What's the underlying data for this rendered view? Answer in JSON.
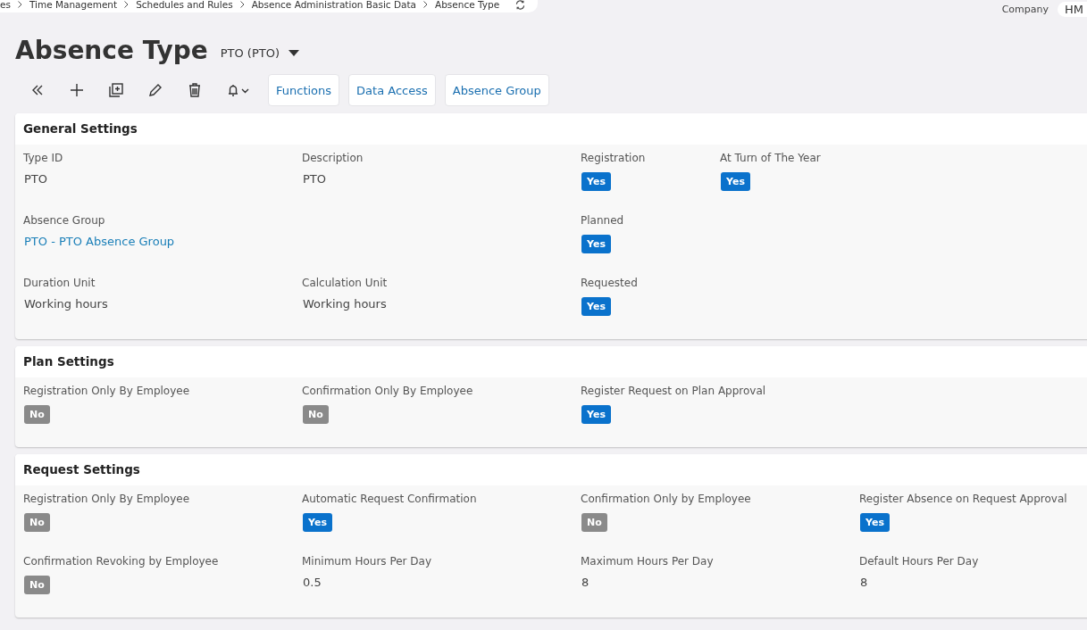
{
  "breadcrumbs": [
    "es",
    "Time Management",
    "Schedules and Rules",
    "Absence Administration Basic Data",
    "Absence Type"
  ],
  "company": {
    "label": "Company",
    "value": "HM"
  },
  "title": "Absence Type",
  "record": "PTO (PTO)",
  "toolbar_buttons": [
    "Functions",
    "Data Access",
    "Absence Group"
  ],
  "sections": [
    {
      "title": "General Settings",
      "rows": [
        [
          {
            "label": "Type ID",
            "kind": "text",
            "value": "PTO"
          },
          "",
          {
            "label": "Description",
            "kind": "text",
            "value": "PTO"
          },
          "",
          {
            "label": "Registration",
            "kind": "toggle",
            "on": true,
            "value": "Yes"
          },
          {
            "label": "At Turn of The Year",
            "kind": "toggle",
            "on": true,
            "value": "Yes"
          }
        ],
        [
          {
            "label": "Absence Group",
            "kind": "link",
            "value": "PTO - PTO Absence Group"
          },
          "",
          "",
          "",
          {
            "label": "Planned",
            "kind": "toggle",
            "on": true,
            "value": "Yes"
          }
        ],
        [
          {
            "label": "Duration Unit",
            "kind": "text",
            "value": "Working hours"
          },
          "",
          {
            "label": "Calculation Unit",
            "kind": "text",
            "value": "Working hours"
          },
          "",
          {
            "label": "Requested",
            "kind": "toggle",
            "on": true,
            "value": "Yes"
          }
        ]
      ]
    },
    {
      "title": "Plan Settings",
      "rows": [
        [
          {
            "label": "Registration Only By Employee",
            "kind": "toggle",
            "on": false,
            "value": "No"
          },
          "",
          {
            "label": "Confirmation Only By Employee",
            "kind": "toggle",
            "on": false,
            "value": "No"
          },
          "",
          {
            "label": "Register Request on Plan Approval",
            "kind": "toggle",
            "on": true,
            "value": "Yes"
          }
        ]
      ]
    },
    {
      "title": "Request Settings",
      "rows": [
        [
          {
            "label": "Registration Only By Employee",
            "kind": "toggle",
            "on": false,
            "value": "No"
          },
          "",
          {
            "label": "Automatic Request Confirmation",
            "kind": "toggle",
            "on": true,
            "value": "Yes"
          },
          "",
          {
            "label": "Confirmation Only by Employee",
            "kind": "toggle",
            "on": false,
            "value": "No"
          },
          "",
          {
            "label": "Register Absence on Request Approval",
            "kind": "toggle",
            "on": true,
            "value": "Yes"
          }
        ],
        [
          {
            "label": "Confirmation Revoking by Employee",
            "kind": "toggle",
            "on": false,
            "value": "No"
          },
          "",
          {
            "label": "Minimum Hours Per Day",
            "kind": "text",
            "value": "0.5"
          },
          "",
          {
            "label": "Maximum Hours Per Day",
            "kind": "text",
            "value": "8"
          },
          "",
          {
            "label": "Default Hours Per Day",
            "kind": "text",
            "value": "8"
          }
        ]
      ]
    }
  ]
}
